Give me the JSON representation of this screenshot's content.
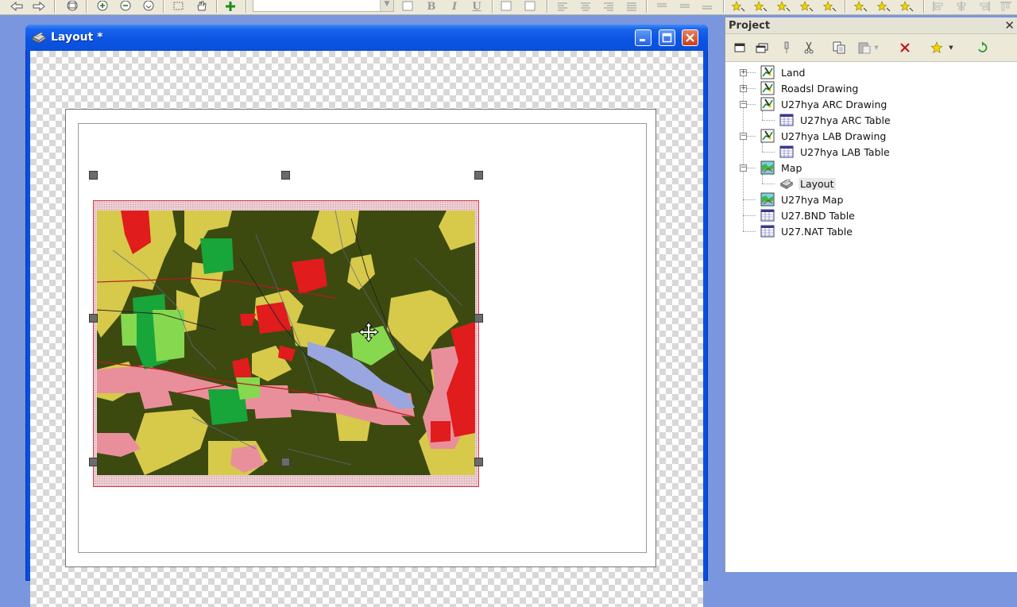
{
  "window": {
    "title": "Layout *"
  },
  "project": {
    "title": "Project",
    "items": [
      {
        "label": "Land",
        "icon": "drawing-icon",
        "level": 0,
        "expander": "+"
      },
      {
        "label": "Roadsl Drawing",
        "icon": "drawing-icon",
        "level": 0,
        "expander": "+"
      },
      {
        "label": "U27hya ARC Drawing",
        "icon": "drawing-icon",
        "level": 0,
        "expander": "-"
      },
      {
        "label": "U27hya ARC Table",
        "icon": "table-icon",
        "level": 1,
        "expander": ""
      },
      {
        "label": "U27hya LAB Drawing",
        "icon": "drawing-icon",
        "level": 0,
        "expander": "-"
      },
      {
        "label": "U27hya LAB Table",
        "icon": "table-icon",
        "level": 1,
        "expander": ""
      },
      {
        "label": "Map",
        "icon": "map-icon",
        "level": 0,
        "expander": "-"
      },
      {
        "label": "Layout",
        "icon": "layout-icon",
        "level": 1,
        "expander": "",
        "selected": true
      },
      {
        "label": "U27hya Map",
        "icon": "map-icon",
        "level": 0,
        "expander": ""
      },
      {
        "label": "U27.BND Table",
        "icon": "table-icon",
        "level": 0,
        "expander": ""
      },
      {
        "label": "U27.NAT Table",
        "icon": "table-icon",
        "level": 0,
        "expander": ""
      }
    ]
  },
  "toolbar": {
    "bold": "B",
    "italic": "I",
    "underline": "U"
  },
  "colors": {
    "titlebar": "#0a54e3",
    "map_forest": "#3c4a10",
    "map_yellow": "#d7c94a",
    "map_pink": "#e98f9c",
    "map_red": "#e01c1c",
    "map_green": "#18a53a",
    "map_lightgreen": "#86d84e",
    "map_blue": "#9aa6e0"
  }
}
